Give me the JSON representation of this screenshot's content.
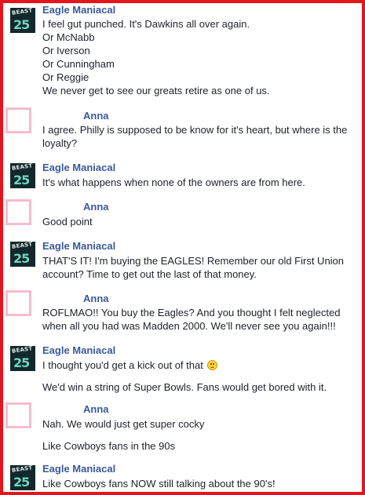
{
  "conversation": {
    "messages": [
      {
        "sender": "Eagle Maniacal",
        "avatar": {
          "label": "BEAST",
          "number": "25"
        },
        "lines": [
          "I feel gut punched. It's Dawkins all over again.",
          "Or McNabb",
          "Or Iverson",
          "Or Cunningham",
          "Or Reggie",
          "We never get to see our greats retire as one of us."
        ]
      },
      {
        "sender": "Anna",
        "lines": [
          "I agree. Philly is supposed to be know for it's heart, but where is the",
          "loyalty?"
        ]
      },
      {
        "sender": "Eagle Maniacal",
        "avatar": {
          "label": "BEAST",
          "number": "25"
        },
        "lines": [
          "It's what happens when none of the owners are from here."
        ]
      },
      {
        "sender": "Anna",
        "lines": [
          "Good point"
        ]
      },
      {
        "sender": "Eagle Maniacal",
        "avatar": {
          "label": "BEAST",
          "number": "25"
        },
        "lines": [
          "THAT'S IT! I'm buying the EAGLES! Remember our old First Union",
          "account? Time to get  out the last of that money."
        ]
      },
      {
        "sender": "Anna",
        "lines": [
          "ROFLMAO!! You buy the Eagles? And you thought I felt neglected",
          "when all you had was Madden 2000. We'll never see you again!!!"
        ]
      },
      {
        "sender": "Eagle Maniacal",
        "avatar": {
          "label": "BEAST",
          "number": "25"
        },
        "lines": [
          "I thought you'd get a kick out of that"
        ],
        "emoji": "smiley-emoji",
        "followup": "We'd win a string of Super Bowls. Fans would get bored with it."
      },
      {
        "sender": "Anna",
        "lines": [
          "Nah. We would just get super cocky"
        ],
        "followup": "Like Cowboys fans in the 90s"
      },
      {
        "sender": "Eagle Maniacal",
        "avatar": {
          "label": "BEAST",
          "number": "25"
        },
        "lines": [
          "Like Cowboys fans NOW still talking about the 90's!"
        ]
      }
    ]
  },
  "colors": {
    "frame": "#e8141c",
    "sender": "#3b5998",
    "text": "#1d2129",
    "anna_avatar_border": "#f6bccd"
  }
}
